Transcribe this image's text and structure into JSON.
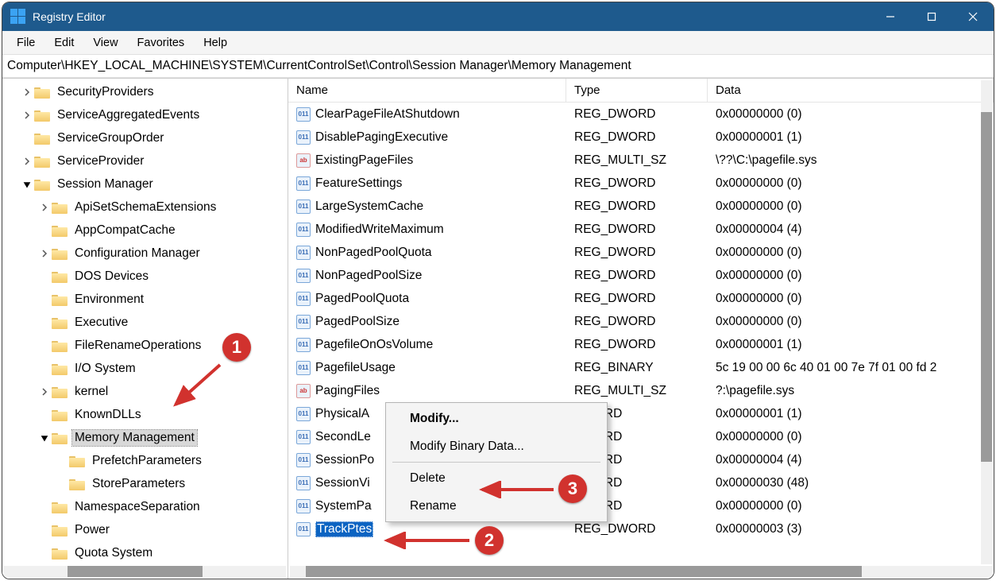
{
  "window": {
    "title": "Registry Editor"
  },
  "menu": {
    "file": "File",
    "edit": "Edit",
    "view": "View",
    "favorites": "Favorites",
    "help": "Help"
  },
  "address": "Computer\\HKEY_LOCAL_MACHINE\\SYSTEM\\CurrentControlSet\\Control\\Session Manager\\Memory Management",
  "tree": [
    {
      "d": 1,
      "c": "r",
      "n": "SecurityProviders"
    },
    {
      "d": 1,
      "c": "r",
      "n": "ServiceAggregatedEvents"
    },
    {
      "d": 1,
      "c": "",
      "n": "ServiceGroupOrder"
    },
    {
      "d": 1,
      "c": "r",
      "n": "ServiceProvider"
    },
    {
      "d": 1,
      "c": "d",
      "n": "Session Manager"
    },
    {
      "d": 2,
      "c": "r",
      "n": "ApiSetSchemaExtensions"
    },
    {
      "d": 2,
      "c": "",
      "n": "AppCompatCache"
    },
    {
      "d": 2,
      "c": "r",
      "n": "Configuration Manager"
    },
    {
      "d": 2,
      "c": "",
      "n": "DOS Devices"
    },
    {
      "d": 2,
      "c": "",
      "n": "Environment"
    },
    {
      "d": 2,
      "c": "",
      "n": "Executive"
    },
    {
      "d": 2,
      "c": "",
      "n": "FileRenameOperations"
    },
    {
      "d": 2,
      "c": "",
      "n": "I/O System"
    },
    {
      "d": 2,
      "c": "r",
      "n": "kernel"
    },
    {
      "d": 2,
      "c": "",
      "n": "KnownDLLs"
    },
    {
      "d": 2,
      "c": "d",
      "n": "Memory Management",
      "sel": true
    },
    {
      "d": 3,
      "c": "",
      "n": "PrefetchParameters"
    },
    {
      "d": 3,
      "c": "",
      "n": "StoreParameters"
    },
    {
      "d": 2,
      "c": "",
      "n": "NamespaceSeparation"
    },
    {
      "d": 2,
      "c": "",
      "n": "Power"
    },
    {
      "d": 2,
      "c": "",
      "n": "Quota System"
    }
  ],
  "headers": {
    "name": "Name",
    "type": "Type",
    "data": "Data"
  },
  "values": [
    {
      "i": "n",
      "n": "ClearPageFileAtShutdown",
      "t": "REG_DWORD",
      "d": "0x00000000 (0)"
    },
    {
      "i": "n",
      "n": "DisablePagingExecutive",
      "t": "REG_DWORD",
      "d": "0x00000001 (1)"
    },
    {
      "i": "s",
      "n": "ExistingPageFiles",
      "t": "REG_MULTI_SZ",
      "d": "\\??\\C:\\pagefile.sys"
    },
    {
      "i": "n",
      "n": "FeatureSettings",
      "t": "REG_DWORD",
      "d": "0x00000000 (0)"
    },
    {
      "i": "n",
      "n": "LargeSystemCache",
      "t": "REG_DWORD",
      "d": "0x00000000 (0)"
    },
    {
      "i": "n",
      "n": "ModifiedWriteMaximum",
      "t": "REG_DWORD",
      "d": "0x00000004 (4)"
    },
    {
      "i": "n",
      "n": "NonPagedPoolQuota",
      "t": "REG_DWORD",
      "d": "0x00000000 (0)"
    },
    {
      "i": "n",
      "n": "NonPagedPoolSize",
      "t": "REG_DWORD",
      "d": "0x00000000 (0)"
    },
    {
      "i": "n",
      "n": "PagedPoolQuota",
      "t": "REG_DWORD",
      "d": "0x00000000 (0)"
    },
    {
      "i": "n",
      "n": "PagedPoolSize",
      "t": "REG_DWORD",
      "d": "0x00000000 (0)"
    },
    {
      "i": "n",
      "n": "PagefileOnOsVolume",
      "t": "REG_DWORD",
      "d": "0x00000001 (1)"
    },
    {
      "i": "n",
      "n": "PagefileUsage",
      "t": "REG_BINARY",
      "d": "5c 19 00 00 6c 40 01 00 7e 7f 01 00 fd 2"
    },
    {
      "i": "s",
      "n": "PagingFiles",
      "t": "REG_MULTI_SZ",
      "d": "?:\\pagefile.sys"
    },
    {
      "i": "n",
      "n": "PhysicalA",
      "t": "DWORD",
      "d": "0x00000001 (1)"
    },
    {
      "i": "n",
      "n": "SecondLe",
      "t": "DWORD",
      "d": "0x00000000 (0)"
    },
    {
      "i": "n",
      "n": "SessionPo",
      "t": "DWORD",
      "d": "0x00000004 (4)"
    },
    {
      "i": "n",
      "n": "SessionVi",
      "t": "DWORD",
      "d": "0x00000030 (48)"
    },
    {
      "i": "n",
      "n": "SystemPa",
      "t": "DWORD",
      "d": "0x00000000 (0)"
    },
    {
      "i": "n",
      "n": "TrackPtes",
      "t": "REG_DWORD",
      "d": "0x00000003 (3)",
      "sel": true
    }
  ],
  "context": {
    "modify": "Modify...",
    "modifyBinary": "Modify Binary Data...",
    "delete": "Delete",
    "rename": "Rename"
  },
  "badges": {
    "b1": "1",
    "b2": "2",
    "b3": "3"
  }
}
